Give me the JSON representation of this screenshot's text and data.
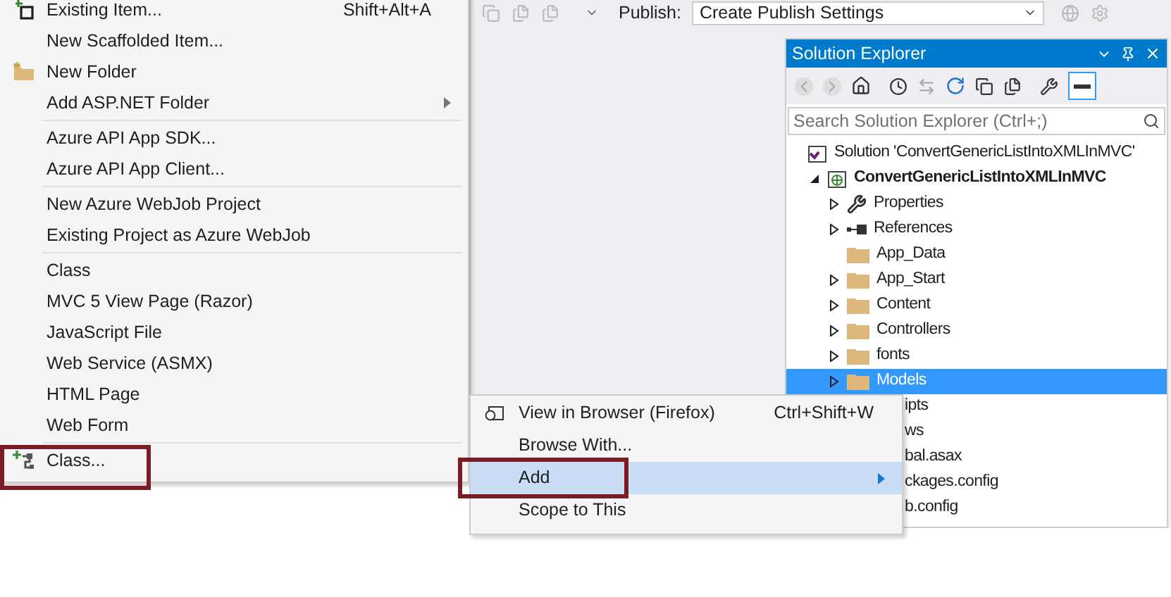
{
  "toolbar": {
    "publish_label": "Publish:",
    "publish_value": "Create Publish Settings"
  },
  "add_menu": {
    "items": [
      {
        "kind": "add-item",
        "label": "Existing Item...",
        "shortcut": "Shift+Alt+A"
      },
      {
        "kind": "item",
        "label": "New Scaffolded Item..."
      },
      {
        "kind": "folder-item",
        "label": "New Folder"
      },
      {
        "kind": "item",
        "label": "Add ASP.NET Folder",
        "submenu": true
      },
      {
        "kind": "separator"
      },
      {
        "kind": "item",
        "label": "Azure API App SDK..."
      },
      {
        "kind": "item",
        "label": "Azure API App Client..."
      },
      {
        "kind": "separator"
      },
      {
        "kind": "item",
        "label": "New Azure WebJob Project"
      },
      {
        "kind": "item",
        "label": "Existing Project as Azure WebJob"
      },
      {
        "kind": "separator"
      },
      {
        "kind": "item",
        "label": "Class"
      },
      {
        "kind": "item",
        "label": "MVC 5 View Page (Razor)"
      },
      {
        "kind": "item",
        "label": "JavaScript File"
      },
      {
        "kind": "item",
        "label": "Web Service (ASMX)"
      },
      {
        "kind": "item",
        "label": "HTML Page"
      },
      {
        "kind": "item",
        "label": "Web Form"
      },
      {
        "kind": "separator"
      },
      {
        "kind": "class-item",
        "label": "Class..."
      }
    ]
  },
  "solution_explorer": {
    "title": "Solution Explorer",
    "search_placeholder": "Search Solution Explorer (Ctrl+;)",
    "tree": [
      {
        "kind": "solution",
        "label": "Solution 'ConvertGenericListIntoXMLInMVC'",
        "children": [
          {
            "kind": "project",
            "label": "ConvertGenericListIntoXMLInMVC",
            "expanded": true,
            "children": [
              {
                "kind": "properties",
                "label": "Properties",
                "expanded": false,
                "selected": false
              },
              {
                "kind": "references",
                "label": "References",
                "expanded": false,
                "selected": false
              },
              {
                "kind": "folder",
                "label": "App_Data",
                "selected": false
              },
              {
                "kind": "folder",
                "label": "App_Start",
                "expanded": false,
                "selected": false
              },
              {
                "kind": "folder",
                "label": "Content",
                "expanded": false,
                "selected": false
              },
              {
                "kind": "folder",
                "label": "Controllers",
                "expanded": false,
                "selected": false
              },
              {
                "kind": "folder",
                "label": "fonts",
                "expanded": false,
                "selected": false
              },
              {
                "kind": "folder",
                "label": "Models",
                "expanded": false,
                "selected": true
              },
              {
                "kind": "partial",
                "label": "ipts"
              },
              {
                "kind": "partial",
                "label": "ws"
              },
              {
                "kind": "partial",
                "label": "bal.asax"
              },
              {
                "kind": "partial",
                "label": "ckages.config"
              },
              {
                "kind": "partial",
                "label": "b.config"
              }
            ]
          }
        ]
      }
    ]
  },
  "context_menu": {
    "items": [
      {
        "kind": "browser-item",
        "label": "View in Browser (Firefox)",
        "shortcut": "Ctrl+Shift+W",
        "selected": false
      },
      {
        "kind": "item",
        "label": "Browse With...",
        "selected": false
      },
      {
        "kind": "item",
        "label": "Add",
        "submenu": true,
        "selected": true
      },
      {
        "kind": "item",
        "label": "Scope to This",
        "selected": false
      }
    ]
  }
}
